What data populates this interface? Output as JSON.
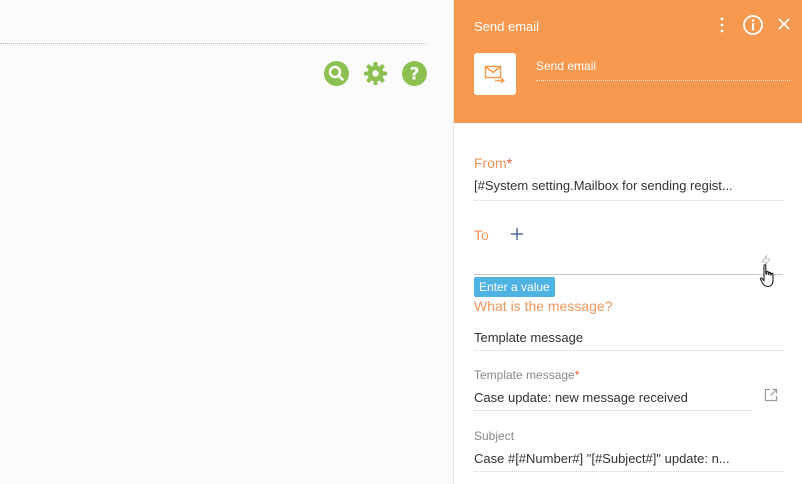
{
  "panel": {
    "title": "Send email",
    "element_name": "Send email"
  },
  "form": {
    "from_label": "From",
    "from_value": "[#System setting.Mailbox for sending regist...",
    "to_label": "To",
    "to_hint": "Enter a value",
    "message_label": "What is the message?",
    "message_value": "Template message",
    "template_label": "Template message",
    "template_value": "Case update: new message received",
    "subject_label": "Subject",
    "subject_value": "Case #[#Number#] \"[#Subject#]\" update: n..."
  },
  "icons": {
    "left_toolbar": [
      "search-icon",
      "gear-icon",
      "help-icon"
    ],
    "header": [
      "kebab-menu-icon",
      "info-icon",
      "close-icon"
    ],
    "element": "email-send-icon",
    "to": [
      "add-icon",
      "lightning-icon",
      "hand-cursor-icon"
    ],
    "template": "open-link-icon"
  },
  "colors": {
    "header_bg": "#f6994f",
    "accent_label": "#f0955a",
    "toolbar_green": "#8cc152",
    "hint_badge": "#4eb2e2"
  }
}
